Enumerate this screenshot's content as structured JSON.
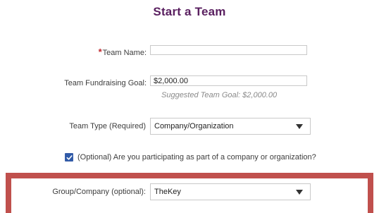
{
  "page": {
    "title": "Start a Team"
  },
  "form": {
    "team_name": {
      "required_marker": "*",
      "label": "Team Name:",
      "value": ""
    },
    "fundraising_goal": {
      "label": "Team Fundraising Goal:",
      "value": "$2,000.00",
      "hint": "Suggested Team Goal: $2,000.00"
    },
    "team_type": {
      "label": "Team Type (Required)",
      "selected": "Company/Organization"
    },
    "company_checkbox": {
      "checked": true,
      "label": "(Optional) Are you participating as part of a company or organization?"
    },
    "group_company": {
      "label": "Group/Company (optional):",
      "selected": "TheKey"
    }
  },
  "colors": {
    "title": "#5a2060",
    "required_star": "#c0272d",
    "highlight_frame": "#c0504d",
    "checkbox_fill": "#2f5aa8"
  },
  "icons": {
    "dropdown": "chevron-down-icon",
    "checkbox": "checkmark-icon"
  }
}
